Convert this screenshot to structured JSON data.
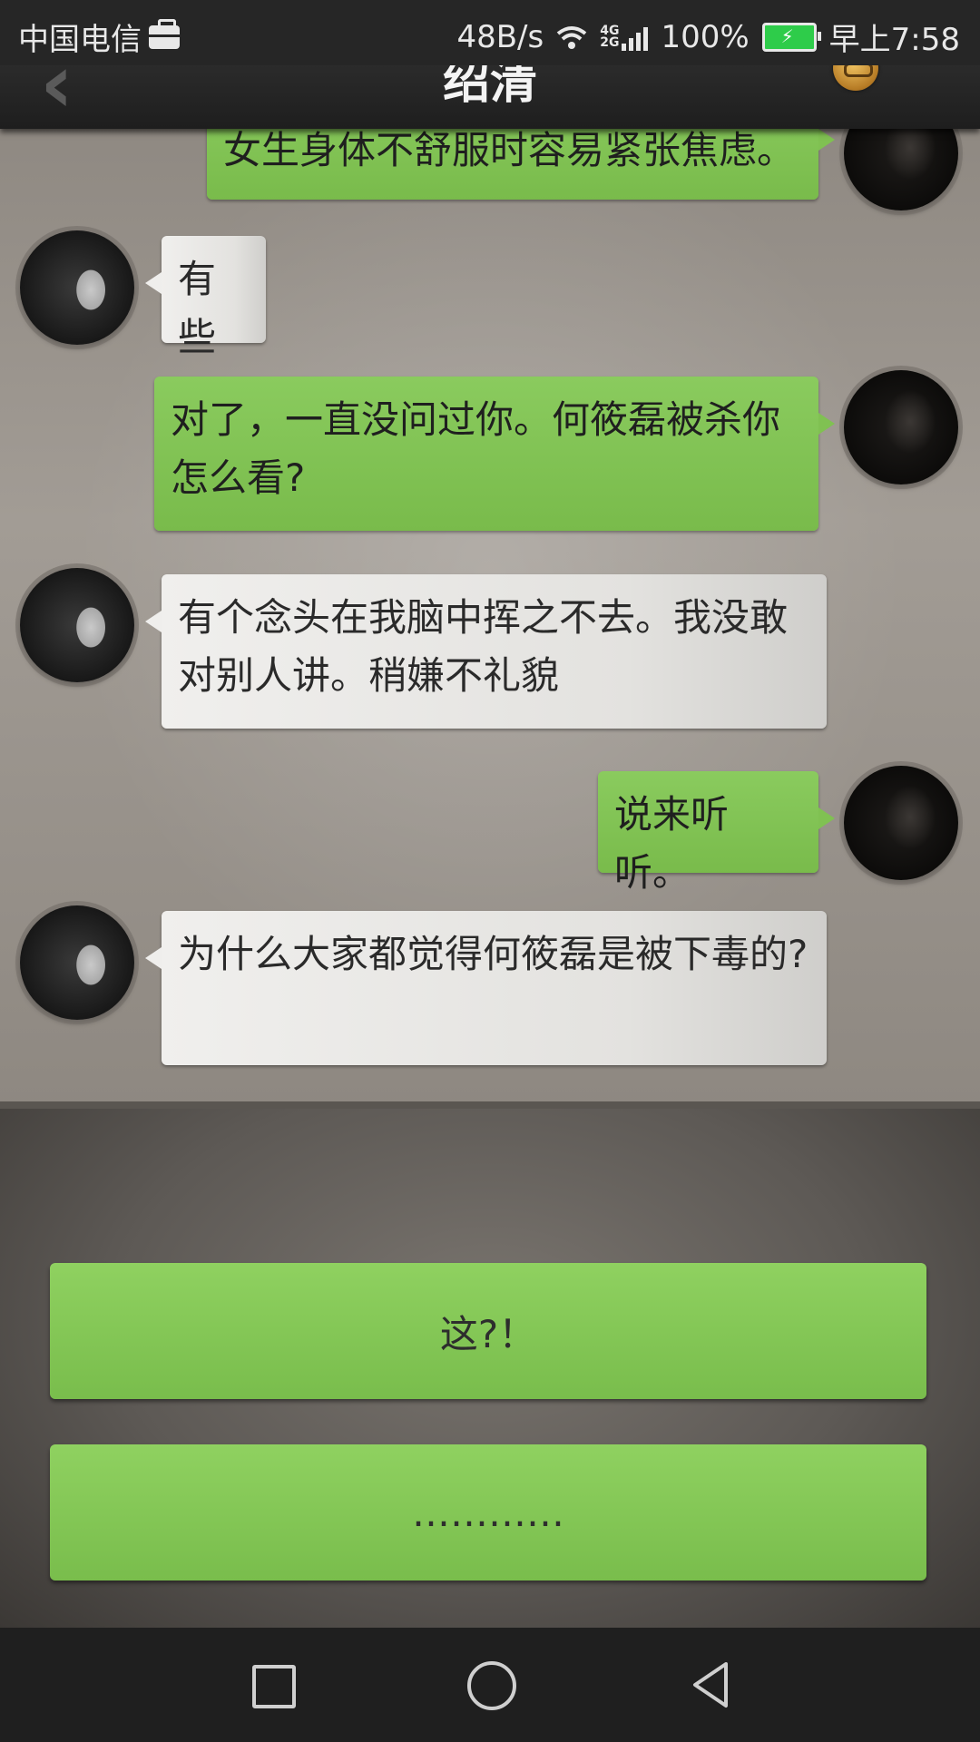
{
  "status_bar": {
    "carrier": "中国电信",
    "net_speed": "48B/s",
    "network_4g": "4G",
    "network_2g": "2G",
    "battery": "100%",
    "time": "早上7:58"
  },
  "header": {
    "title": "绍清"
  },
  "messages": [
    {
      "sender": "me",
      "text": "女生身体不舒服时容易紧张焦虑。"
    },
    {
      "sender": "her",
      "text": "有些"
    },
    {
      "sender": "me",
      "text": "对了，一直没问过你。何筱磊被杀你怎么看?"
    },
    {
      "sender": "her",
      "text": "有个念头在我脑中挥之不去。我没敢对别人讲。稍嫌不礼貌"
    },
    {
      "sender": "me",
      "text": "说来听听。"
    },
    {
      "sender": "her",
      "text": "为什么大家都觉得何筱磊是被下毒的?"
    }
  ],
  "reply_options": [
    {
      "label": "这?！"
    },
    {
      "label": "…………"
    }
  ],
  "colors": {
    "bubble_green": "#80c152",
    "reply_green": "#86c95a"
  },
  "icons": {
    "back": "chevron-left-icon",
    "profile": "glasses-badge-icon",
    "nav_recents": "square-icon",
    "nav_home": "circle-icon",
    "nav_back": "triangle-back-icon"
  }
}
